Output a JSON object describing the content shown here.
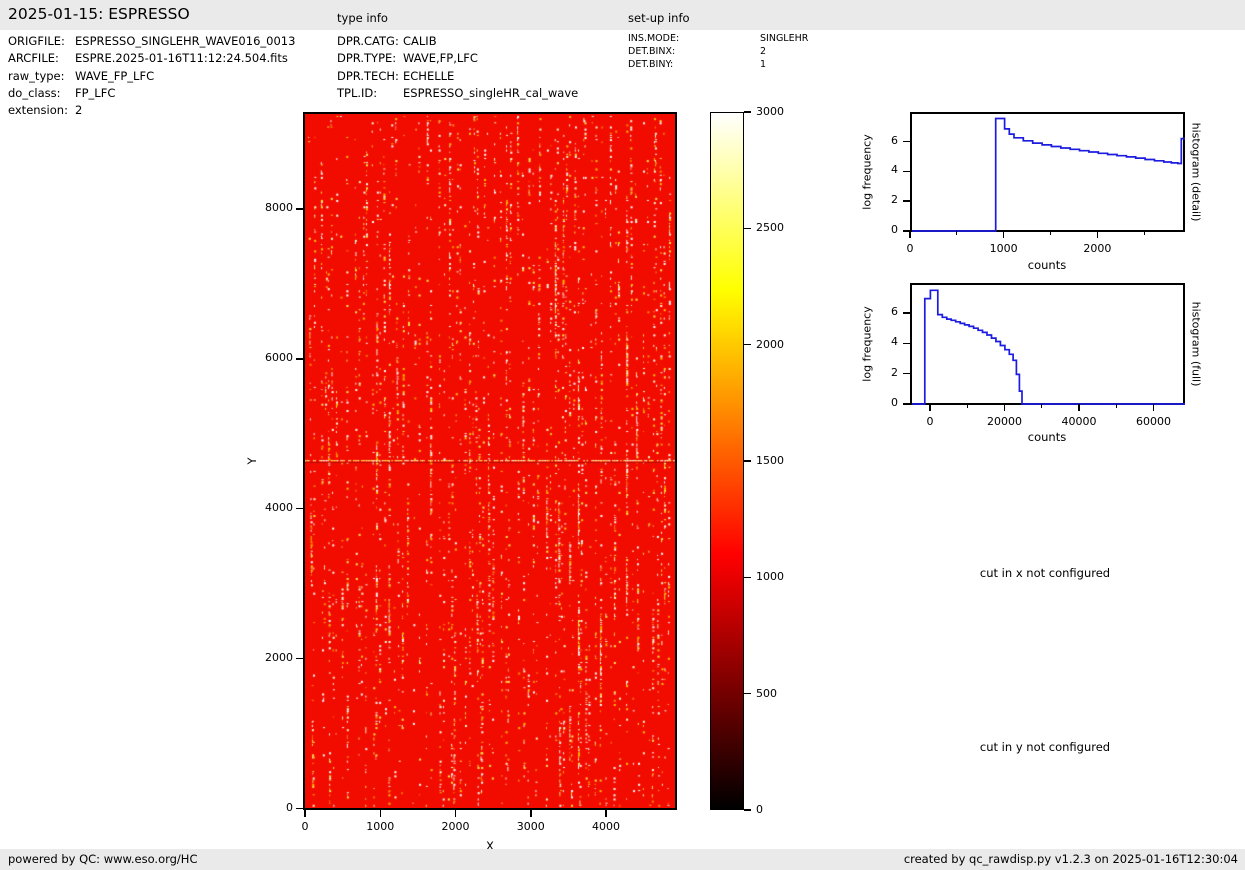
{
  "header": {
    "title": "2025-01-15: ESPRESSO",
    "type_info_label": "type info",
    "setup_info_label": "set-up info"
  },
  "file_info": [
    {
      "label": "ORIGFILE:",
      "value": "ESPRESSO_SINGLEHR_WAVE016_0013"
    },
    {
      "label": "ARCFILE:",
      "value": "ESPRE.2025-01-16T11:12:24.504.fits"
    },
    {
      "label": "raw_type:",
      "value": "WAVE_FP_LFC"
    },
    {
      "label": "do_class:",
      "value": "FP_LFC"
    },
    {
      "label": "extension:",
      "value": "2"
    }
  ],
  "type_info": [
    {
      "label": "DPR.CATG:",
      "value": "CALIB"
    },
    {
      "label": "DPR.TYPE:",
      "value": "WAVE,FP,LFC"
    },
    {
      "label": "DPR.TECH:",
      "value": "ECHELLE"
    },
    {
      "label": "TPL.ID:",
      "value": "ESPRESSO_singleHR_cal_wave"
    }
  ],
  "setup_info": [
    {
      "label": "INS.MODE:",
      "value": "SINGLEHR"
    },
    {
      "label": "DET.BINX:",
      "value": "2"
    },
    {
      "label": "DET.BINY:",
      "value": "1"
    }
  ],
  "messages": {
    "cut_x": "cut in x not configured",
    "cut_y": "cut in y not configured"
  },
  "footer": {
    "left": "powered by QC: www.eso.org/HC",
    "right": "created by qc_rawdisp.py v1.2.3 on 2025-01-16T12:30:04"
  },
  "chart_data": [
    {
      "id": "raw-image",
      "type": "heatmap",
      "xlabel": "X",
      "ylabel": "Y",
      "x_ticks": [
        0,
        1000,
        2000,
        3000,
        4000
      ],
      "y_ticks": [
        0,
        2000,
        4000,
        6000,
        8000
      ],
      "xlim": [
        0,
        4930
      ],
      "ylim": [
        0,
        9280
      ],
      "colormap": "hot",
      "value_range": [
        0,
        3000
      ],
      "background": "#f20c00",
      "palette": [
        "#ffffff",
        "#fffbd0",
        "#ffe94d",
        "#ffc400",
        "#ff8a00"
      ],
      "seam_y_frac": 0.498,
      "description": "raw echelle FP/LFC exposure: red background with curved vertical columns of bright speckles"
    },
    {
      "id": "colorbar",
      "type": "colorbar",
      "ticks": [
        0,
        500,
        1000,
        1500,
        2000,
        2500,
        3000
      ],
      "range": [
        0,
        3000
      ],
      "gradient": [
        [
          0.0,
          "#000000"
        ],
        [
          0.1,
          "#460000"
        ],
        [
          0.2,
          "#8c0000"
        ],
        [
          0.3,
          "#d20000"
        ],
        [
          0.365,
          "#ff0000"
        ],
        [
          0.45,
          "#ff3900"
        ],
        [
          0.55,
          "#ff7c00"
        ],
        [
          0.65,
          "#ffbf00"
        ],
        [
          0.746,
          "#ffff00"
        ],
        [
          0.85,
          "#ffff69"
        ],
        [
          0.93,
          "#ffffb9"
        ],
        [
          1.0,
          "#ffffff"
        ]
      ]
    },
    {
      "id": "histogram-detail",
      "type": "step-line",
      "right_label": "histogram (detail)",
      "xlabel": "counts",
      "ylabel": "log frequency",
      "x_ticks": [
        0,
        1000,
        2000
      ],
      "x_minor_ticks": [
        500,
        1500,
        2500
      ],
      "y_ticks": [
        0,
        2,
        4,
        6
      ],
      "xlim": [
        0,
        2936
      ],
      "ylim": [
        0,
        7.85
      ],
      "line_color": "#1c1ce0",
      "bins": [
        [
          915,
          7.55
        ],
        [
          1010,
          6.85
        ],
        [
          1060,
          6.5
        ],
        [
          1110,
          6.25
        ],
        [
          1210,
          6.05
        ],
        [
          1310,
          5.9
        ],
        [
          1410,
          5.78
        ],
        [
          1510,
          5.67
        ],
        [
          1610,
          5.57
        ],
        [
          1710,
          5.48
        ],
        [
          1810,
          5.39
        ],
        [
          1910,
          5.3
        ],
        [
          2010,
          5.21
        ],
        [
          2110,
          5.13
        ],
        [
          2210,
          5.05
        ],
        [
          2310,
          4.97
        ],
        [
          2410,
          4.89
        ],
        [
          2510,
          4.8
        ],
        [
          2610,
          4.71
        ],
        [
          2710,
          4.63
        ],
        [
          2790,
          4.57
        ],
        [
          2860,
          4.53
        ],
        [
          2896,
          6.2
        ]
      ]
    },
    {
      "id": "histogram-full",
      "type": "step-line",
      "right_label": "histogram (full)",
      "xlabel": "counts",
      "ylabel": "log frequency",
      "x_ticks": [
        0,
        20000,
        40000,
        60000
      ],
      "x_minor_ticks": [
        10000,
        30000,
        50000
      ],
      "y_ticks": [
        0,
        2,
        4,
        6
      ],
      "xlim": [
        -5370,
        68456
      ],
      "ylim": [
        0,
        7.85
      ],
      "line_color": "#1c1ce0",
      "bins": [
        [
          -1400,
          6.95
        ],
        [
          100,
          7.5
        ],
        [
          2100,
          5.9
        ],
        [
          3300,
          5.72
        ],
        [
          4500,
          5.6
        ],
        [
          5700,
          5.52
        ],
        [
          6900,
          5.42
        ],
        [
          8100,
          5.32
        ],
        [
          9300,
          5.22
        ],
        [
          10500,
          5.12
        ],
        [
          11700,
          5.0
        ],
        [
          12900,
          4.86
        ],
        [
          14100,
          4.72
        ],
        [
          15300,
          4.55
        ],
        [
          16500,
          4.35
        ],
        [
          17700,
          4.12
        ],
        [
          18900,
          3.86
        ],
        [
          20100,
          3.58
        ],
        [
          21300,
          3.28
        ],
        [
          22300,
          2.88
        ],
        [
          23200,
          1.95
        ],
        [
          24000,
          0.85
        ],
        [
          24700,
          0
        ]
      ]
    }
  ]
}
